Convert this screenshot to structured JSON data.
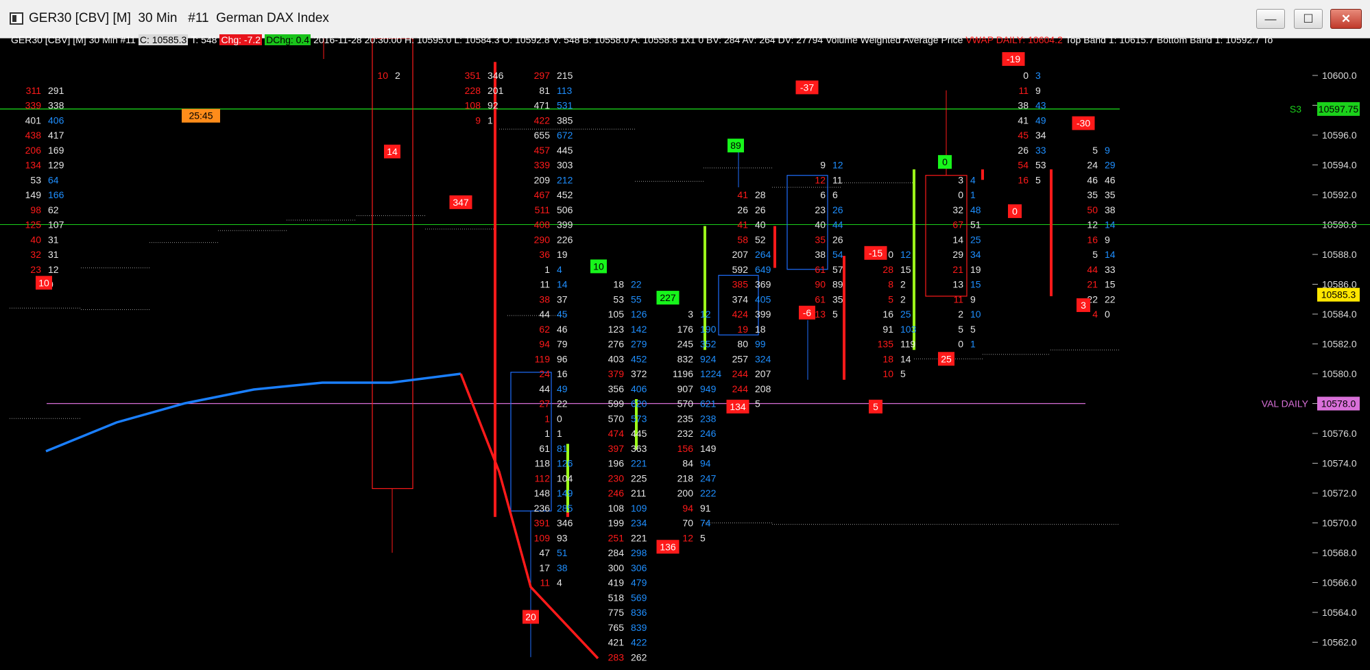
{
  "window": {
    "title": "GER30 [CBV] [M]  30 Min   #11  German DAX Index",
    "min_icon": "—",
    "max_icon": "☐",
    "close_icon": "✕"
  },
  "infobar": {
    "instrument": "GER30 [CBV]  [M]   30 Min    #11",
    "close": "C: 10585.3",
    "rest1": "T: 548",
    "chg": "Chg: -7.2",
    "dchg": "DChg: 0.4",
    "rest2": "2016-11-28 20:30:00  H: 10595.0  L: 10584.3  O: 10592.8  V: 548  B: 10558.0  A: 10558.8  1x1  0  BV: 284  AV: 264  DV: 27794  Volume Weighted Average Price",
    "vwap": "VWAP DAILY: 10604.2",
    "bands": "Top Band 1: 10615.7   Bottom Band 1: 10592.7   To"
  },
  "colors": {
    "bid": "#ff1a1a",
    "ask": "#1f8fff",
    "neutral": "#e6e6e6",
    "green": "#17f51b",
    "red_box": "#ff1a1a",
    "vwap": "#1a7fff",
    "val": "#d970d9",
    "s3": "#1bd11b",
    "last": "#ffe600"
  },
  "axis": {
    "ticks": [
      "10600.0",
      "10598.0",
      "10596.0",
      "10594.0",
      "10592.0",
      "10590.0",
      "10588.0",
      "10586.0",
      "10584.0",
      "10582.0",
      "10580.0",
      "10578.0",
      "10576.0",
      "10574.0",
      "10572.0",
      "10570.0",
      "10568.0",
      "10566.0",
      "10564.0",
      "10562.0"
    ]
  },
  "levels": {
    "s3": {
      "label": "S3",
      "value": "10597.75"
    },
    "val_daily": {
      "label": "VAL DAILY",
      "value": "10578.0"
    },
    "last": {
      "value": "10585.3"
    },
    "guide": "10590.0"
  },
  "timer": "25:45",
  "bars": [
    {
      "id": "b1",
      "start": 10600.0,
      "cells": [
        [
          "",
          ""
        ],
        [
          "311",
          "291"
        ],
        [
          "339",
          "338"
        ],
        [
          "401",
          "406"
        ],
        [
          "438",
          "417"
        ],
        [
          "206",
          "169"
        ],
        [
          "134",
          "129"
        ],
        [
          "53",
          "64"
        ],
        [
          "149",
          "166"
        ],
        [
          "98",
          "62"
        ],
        [
          "125",
          "107"
        ],
        [
          "40",
          "31"
        ],
        [
          "32",
          "31"
        ],
        [
          "23",
          "12"
        ],
        [
          "1",
          "0"
        ]
      ],
      "delta": "10"
    },
    {
      "id": "b2",
      "start": 10600.0,
      "cells": [
        [
          "10",
          "2"
        ]
      ],
      "delta": "14"
    },
    {
      "id": "b3",
      "start": 10600.0,
      "cells": [
        [
          "351",
          "346"
        ],
        [
          "228",
          "201"
        ],
        [
          "108",
          "92"
        ],
        [
          "9",
          "1"
        ]
      ],
      "delta": "347"
    },
    {
      "id": "b4",
      "start": 10600.0,
      "cells": [
        [
          "297",
          "215"
        ],
        [
          "81",
          "113"
        ],
        [
          "471",
          "531"
        ],
        [
          "422",
          "385"
        ],
        [
          "655",
          "672"
        ],
        [
          "457",
          "445"
        ],
        [
          "339",
          "303"
        ],
        [
          "209",
          "212"
        ],
        [
          "467",
          "452"
        ],
        [
          "511",
          "506"
        ],
        [
          "408",
          "399"
        ],
        [
          "290",
          "226"
        ],
        [
          "36",
          "19"
        ],
        [
          "1",
          "4"
        ],
        [
          "11",
          "14"
        ],
        [
          "38",
          "37"
        ],
        [
          "44",
          "45"
        ],
        [
          "62",
          "46"
        ],
        [
          "94",
          "79"
        ],
        [
          "119",
          "96"
        ],
        [
          "24",
          "16"
        ],
        [
          "44",
          "49"
        ],
        [
          "27",
          "22"
        ],
        [
          "1",
          "0"
        ],
        [
          "1",
          "1"
        ],
        [
          "61",
          "81"
        ],
        [
          "118",
          "126"
        ],
        [
          "112",
          "104"
        ],
        [
          "148",
          "149"
        ],
        [
          "236",
          "285"
        ],
        [
          "391",
          "346"
        ],
        [
          "109",
          "93"
        ],
        [
          "47",
          "51"
        ],
        [
          "17",
          "38"
        ],
        [
          "11",
          "4"
        ]
      ],
      "delta": "20"
    },
    {
      "id": "b5",
      "start": 10586.0,
      "cells": [
        [
          "18",
          "22"
        ],
        [
          "53",
          "55"
        ],
        [
          "105",
          "126"
        ],
        [
          "123",
          "142"
        ],
        [
          "276",
          "279"
        ],
        [
          "403",
          "452"
        ],
        [
          "379",
          "372"
        ],
        [
          "356",
          "406"
        ],
        [
          "599",
          "620"
        ],
        [
          "570",
          "573"
        ],
        [
          "474",
          "445"
        ],
        [
          "397",
          "363"
        ],
        [
          "196",
          "221"
        ],
        [
          "230",
          "225"
        ],
        [
          "246",
          "211"
        ],
        [
          "108",
          "109"
        ],
        [
          "199",
          "234"
        ],
        [
          "251",
          "221"
        ],
        [
          "284",
          "298"
        ],
        [
          "300",
          "306"
        ],
        [
          "419",
          "479"
        ],
        [
          "518",
          "569"
        ],
        [
          "775",
          "836"
        ],
        [
          "765",
          "839"
        ],
        [
          "421",
          "422"
        ],
        [
          "283",
          "262"
        ]
      ],
      "delta": "10"
    },
    {
      "id": "b6",
      "start": 10584.0,
      "cells": [
        [
          "3",
          "12"
        ],
        [
          "176",
          "190"
        ],
        [
          "245",
          "352"
        ],
        [
          "832",
          "924"
        ],
        [
          "1196",
          "1224"
        ],
        [
          "907",
          "949"
        ],
        [
          "570",
          "621"
        ],
        [
          "235",
          "238"
        ],
        [
          "232",
          "246"
        ],
        [
          "156",
          "149"
        ],
        [
          "84",
          "94"
        ],
        [
          "218",
          "247"
        ],
        [
          "200",
          "222"
        ],
        [
          "94",
          "91"
        ],
        [
          "70",
          "74"
        ],
        [
          "12",
          "5"
        ]
      ],
      "delta": "227",
      "delta2": "136"
    },
    {
      "id": "b7",
      "start": 10592.0,
      "cells": [
        [
          "41",
          "28"
        ],
        [
          "26",
          "26"
        ],
        [
          "41",
          "40"
        ],
        [
          "58",
          "52"
        ],
        [
          "207",
          "264"
        ],
        [
          "592",
          "649"
        ],
        [
          "385",
          "369"
        ],
        [
          "374",
          "405"
        ],
        [
          "424",
          "399"
        ],
        [
          "19",
          "18"
        ],
        [
          "80",
          "99"
        ],
        [
          "257",
          "324"
        ],
        [
          "244",
          "207"
        ],
        [
          "244",
          "208"
        ],
        [
          "6",
          "5"
        ]
      ],
      "delta": "89",
      "delta2": "134"
    },
    {
      "id": "b8",
      "start": 10594.0,
      "cells": [
        [
          "9",
          "12"
        ],
        [
          "12",
          "11"
        ],
        [
          "6",
          "6"
        ],
        [
          "23",
          "26"
        ],
        [
          "40",
          "44"
        ],
        [
          "35",
          "26"
        ],
        [
          "38",
          "54"
        ],
        [
          "61",
          "57"
        ],
        [
          "90",
          "89"
        ],
        [
          "61",
          "35"
        ],
        [
          "13",
          "5"
        ]
      ],
      "delta": "-37",
      "delta2": "-6"
    },
    {
      "id": "b9",
      "start": 10588.0,
      "cells": [
        [
          "0",
          "12"
        ],
        [
          "28",
          "15"
        ],
        [
          "8",
          "2"
        ],
        [
          "5",
          "2"
        ],
        [
          "16",
          "25"
        ],
        [
          "91",
          "103"
        ],
        [
          "135",
          "119"
        ],
        [
          "18",
          "14"
        ],
        [
          "10",
          "5"
        ]
      ],
      "delta": "-15",
      "delta2": "5"
    },
    {
      "id": "b10",
      "start": 10593.0,
      "cells": [
        [
          "3",
          "4"
        ],
        [
          "0",
          "1"
        ],
        [
          "32",
          "48"
        ],
        [
          "67",
          "51"
        ],
        [
          "14",
          "25"
        ],
        [
          "29",
          "34"
        ],
        [
          "21",
          "19"
        ],
        [
          "13",
          "15"
        ],
        [
          "11",
          "9"
        ],
        [
          "2",
          "10"
        ],
        [
          "5",
          "5"
        ],
        [
          "0",
          "1"
        ]
      ],
      "delta": "0",
      "delta2": "25"
    },
    {
      "id": "b11",
      "start": 10600.0,
      "cells": [
        [
          "0",
          "3"
        ],
        [
          "11",
          "9"
        ],
        [
          "38",
          "43"
        ],
        [
          "41",
          "49"
        ],
        [
          "45",
          "34"
        ],
        [
          "26",
          "33"
        ],
        [
          "54",
          "53"
        ],
        [
          "16",
          "5"
        ]
      ],
      "delta": "-19",
      "delta2": "0"
    },
    {
      "id": "b12",
      "start": 10595.0,
      "cells": [
        [
          "5",
          "9"
        ],
        [
          "24",
          "29"
        ],
        [
          "46",
          "46"
        ],
        [
          "35",
          "35"
        ],
        [
          "50",
          "38"
        ],
        [
          "12",
          "14"
        ],
        [
          "16",
          "9"
        ],
        [
          "5",
          "14"
        ],
        [
          "44",
          "33"
        ],
        [
          "21",
          "15"
        ],
        [
          "22",
          "22"
        ],
        [
          "4",
          "0"
        ]
      ],
      "delta": "-30",
      "delta2": "3"
    }
  ]
}
